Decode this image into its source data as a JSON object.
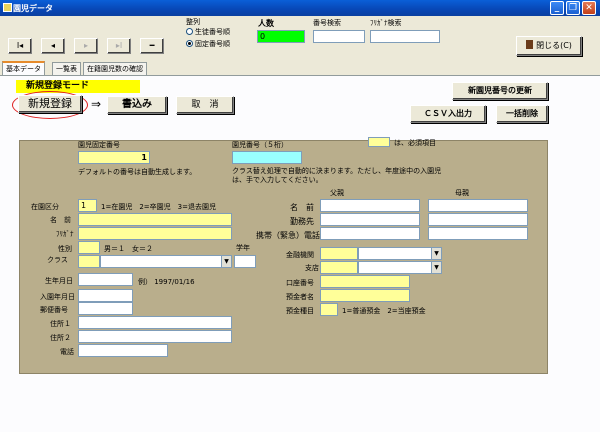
{
  "window": {
    "title": "園児データ",
    "minimize": "_",
    "restore": "❐",
    "close": "✕"
  },
  "toolbar": {
    "nav": {
      "first": "I◂",
      "prev": "◂",
      "next": "▸",
      "last": "▸I",
      "delete": "━"
    },
    "sort": {
      "label": "整列",
      "option1": "生徒番号順",
      "option2": "固定番号順",
      "selected": "固定番号順"
    },
    "count": {
      "label": "人数",
      "value": "0"
    },
    "number_search": {
      "label": "番号検索",
      "value": ""
    },
    "kana_search": {
      "label": "ﾌﾘｶﾞﾅ検索",
      "value": ""
    },
    "close_label": "閉じる(C)"
  },
  "tabs": [
    "基本データ",
    "一覧表",
    "在籍園児数の確認"
  ],
  "active_tab": "基本データ",
  "mode": {
    "label": "新規登録モード",
    "color": "#ffff00"
  },
  "actions": {
    "new_register": "新規登録",
    "arrow": "⇒",
    "write": "書込み",
    "cancel": "取　消",
    "update_number": "新園児番号の更新",
    "csv": "ＣＳＶ入出力",
    "bulk_delete": "一括削除"
  },
  "legend": {
    "text": "は、必須項目"
  },
  "form": {
    "fixed_number": {
      "label": "園児固定番号",
      "value": "1"
    },
    "fixed_note": "デフォルトの番号は自動生成します。",
    "child_number": {
      "label": "園児番号（５桁）",
      "value": ""
    },
    "child_note": "クラス替え処理で自動的に決まります。ただし、年度途中の入園児は、手で入力してください。",
    "enrollment": {
      "label": "在園区分",
      "value": "1",
      "note": "1=在園児　2=卒園児　3=退去園児"
    },
    "name": {
      "label": "名　前",
      "value": ""
    },
    "kana": {
      "label": "ﾌﾘｶﾞﾅ",
      "value": ""
    },
    "gender": {
      "label": "性別",
      "value": "",
      "note": "男＝１　女＝２"
    },
    "klass": {
      "label": "クラス",
      "value": "",
      "grade_label": "学年"
    },
    "birthday": {
      "label": "生年月日",
      "value": "",
      "note": "例） 1997/01/16"
    },
    "entry_date": {
      "label": "入園年月日",
      "value": ""
    },
    "postal": {
      "label": "郵便番号",
      "value": ""
    },
    "address1": {
      "label": "住所１",
      "value": ""
    },
    "address2": {
      "label": "住所２",
      "value": ""
    },
    "phone": {
      "label": "電話",
      "value": ""
    },
    "parents": {
      "father": "父親",
      "mother": "母親",
      "name_label": "名　前",
      "work_label": "勤務先",
      "mobile_label": "携帯（緊急）電話"
    },
    "bank": {
      "institution_label": "金融機関",
      "branch_label": "支店",
      "account_no_label": "口座番号",
      "holder_label": "預金者名",
      "type_label": "預金種目",
      "type_note": "1=普通預金　2=当座預金"
    }
  }
}
